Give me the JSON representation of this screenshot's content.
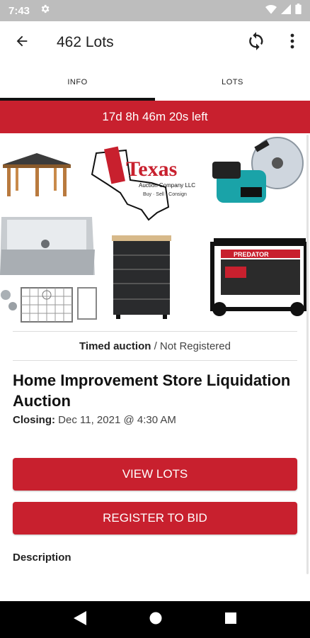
{
  "status_bar": {
    "time": "7:43",
    "icons": [
      "gear-icon",
      "wifi-icon",
      "signal-icon",
      "battery-icon"
    ]
  },
  "app_bar": {
    "title": "462 Lots",
    "icons": [
      "back-arrow-icon",
      "refresh-icon",
      "more-vert-icon"
    ]
  },
  "tabs": [
    {
      "label": "INFO",
      "active": true
    },
    {
      "label": "LOTS",
      "active": false
    }
  ],
  "timer": {
    "text": "17d 8h 46m 20s left"
  },
  "logo": {
    "brand": "Texas",
    "company": "Auction Company LLC",
    "tagline": "Buy · Sell · Consign"
  },
  "generator_brand": "PREDATOR",
  "auction": {
    "type": "Timed auction",
    "registration": "/ Not Registered",
    "title": "Home Improvement Store Liquidation Auction",
    "closing_label": "Closing:",
    "closing_date": "Dec 11, 2021 @ 4:30 AM"
  },
  "buttons": {
    "view_lots": "VIEW LOTS",
    "register": "REGISTER TO BID"
  },
  "description_label": "Description",
  "colors": {
    "accent": "#c8202e",
    "status_bar": "#bdbdbd",
    "nav_bar": "#000000"
  }
}
